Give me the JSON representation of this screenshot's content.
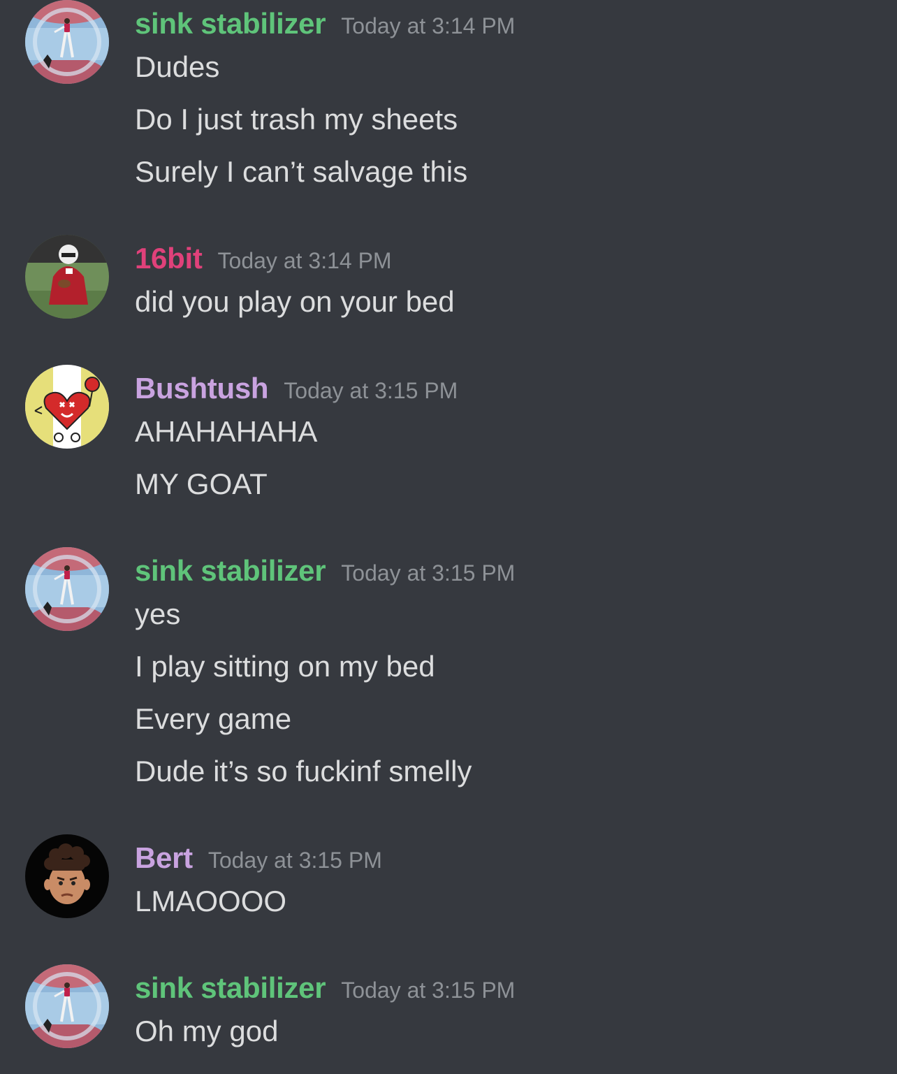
{
  "colors": {
    "background": "#36393f",
    "timestamp": "#8e9297",
    "message_text": "#dcddde",
    "sink_stabilizer": "#5fc47a",
    "sixteen_bit": "#e0417a",
    "bushtush": "#c9a3e0",
    "bert": "#c9a3e0"
  },
  "groups": [
    {
      "author": "sink stabilizer",
      "timestamp": "Today at 3:14 PM",
      "avatar": "plane-wing-figure-avatar",
      "messages": [
        "Dudes",
        "Do I just trash my sheets",
        "Surely I can’t salvage this"
      ]
    },
    {
      "author": "16bit",
      "timestamp": "Today at 3:14 PM",
      "avatar": "football-player-avatar",
      "messages": [
        "did you play on your bed"
      ]
    },
    {
      "author": "Bushtush",
      "timestamp": "Today at 3:15 PM",
      "avatar": "cartoon-heart-stop-sign-avatar",
      "messages": [
        "AHAHAHAHA",
        "MY GOAT"
      ]
    },
    {
      "author": "sink stabilizer",
      "timestamp": "Today at 3:15 PM",
      "avatar": "plane-wing-figure-avatar",
      "messages": [
        "yes",
        "I play sitting on my bed",
        "Every game",
        "Dude it’s so fuckinf smelly"
      ]
    },
    {
      "author": "Bert",
      "timestamp": "Today at 3:15 PM",
      "avatar": "memoji-face-avatar",
      "messages": [
        "LMAOOOO"
      ]
    },
    {
      "author": "sink stabilizer",
      "timestamp": "Today at 3:15 PM",
      "avatar": "plane-wing-figure-avatar",
      "messages": [
        "Oh my god"
      ]
    }
  ]
}
